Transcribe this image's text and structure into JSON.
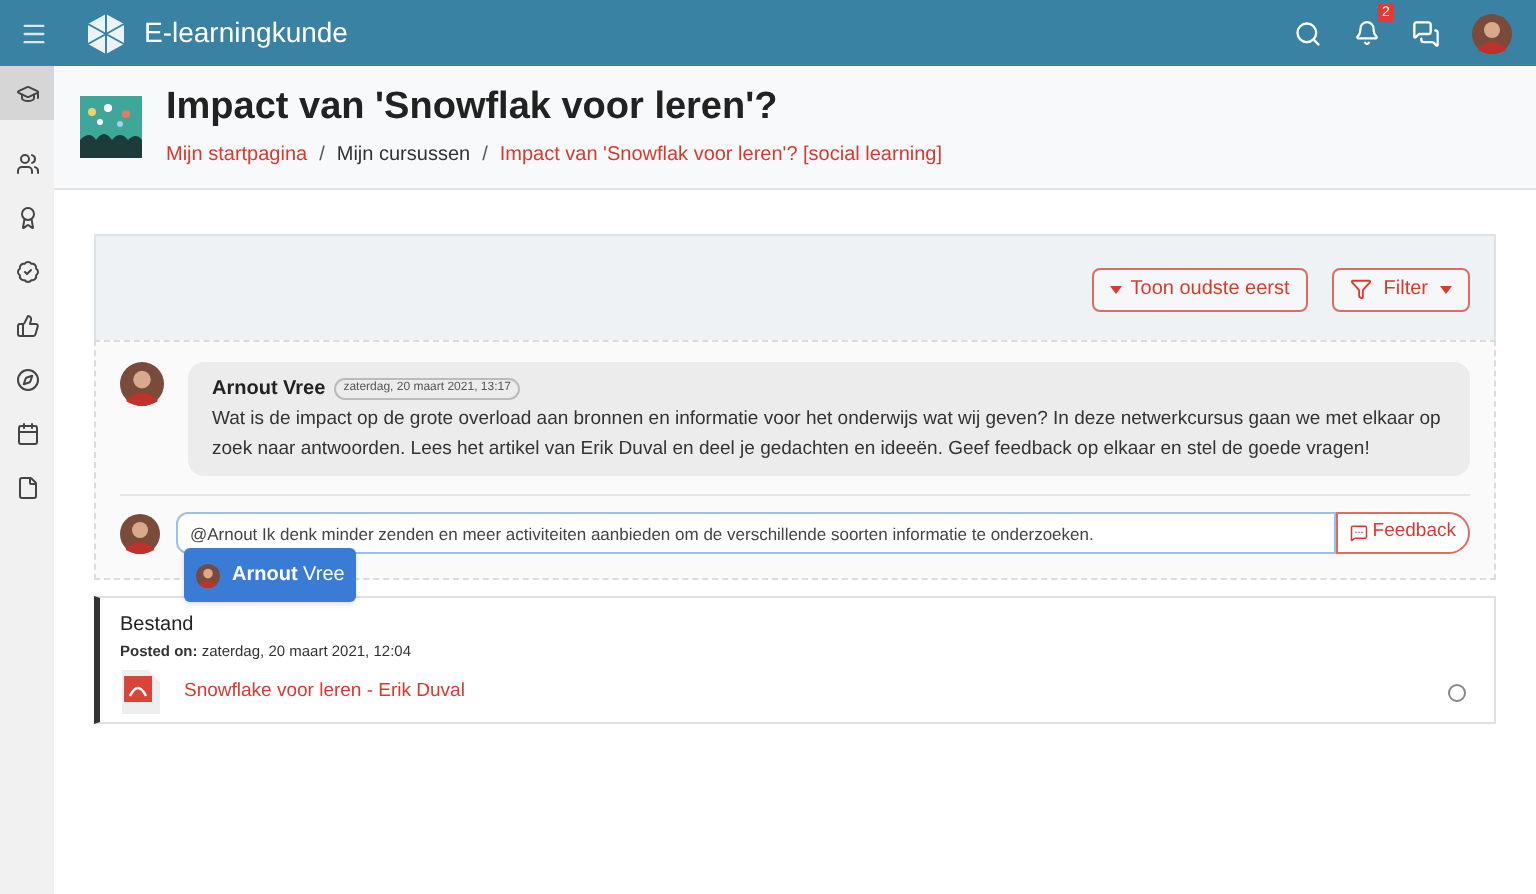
{
  "header": {
    "site_name": "E-learningkunde",
    "notification_count": "2"
  },
  "sidebar": {
    "items": [
      {
        "kind": "cap",
        "selected": true
      },
      {
        "kind": "users",
        "selected": false
      },
      {
        "kind": "award",
        "selected": false
      },
      {
        "kind": "badge",
        "selected": false
      },
      {
        "kind": "thumb",
        "selected": false
      },
      {
        "kind": "compass",
        "selected": false
      },
      {
        "kind": "calendar",
        "selected": false
      },
      {
        "kind": "file",
        "selected": false
      }
    ]
  },
  "page": {
    "title": "Impact van 'Snowflak voor leren'?",
    "separator": "/",
    "breadcrumbs": [
      {
        "label": "Mijn startpagina",
        "link": true
      },
      {
        "label": "Mijn cursussen",
        "link": false
      },
      {
        "label": "Impact van 'Snowflak voor leren'? [social learning]",
        "link": true
      }
    ]
  },
  "toolbar": {
    "sort_button": "Toon oudste eerst",
    "filter_button": "Filter"
  },
  "post": {
    "author": "Arnout Vree",
    "date": "zaterdag, 20 maart 2021, 13:17",
    "text": "Wat is de impact op de grote overload aan bronnen en informatie voor het onderwijs wat wij geven? In deze netwerkcursus gaan we met elkaar op zoek naar antwoorden. Lees het artikel van Erik Duval en deel je gedachten en ideeën. Geef feedback op elkaar en stel de goede vragen!",
    "reply": {
      "value": "@Arnout Ik denk minder zenden en meer activiteiten aanbieden om de verschillende soorten informatie te onderzoeken.",
      "button": "Feedback",
      "mention_suggestion": "**Arnout** Vree"
    }
  },
  "file_card": {
    "title": "Bestand",
    "posted_on": "**Posted on:** zaterdag, 20 maart 2021, 12:04",
    "file_link": "Snowflake voor leren - Erik Duval",
    "selected": false
  }
}
